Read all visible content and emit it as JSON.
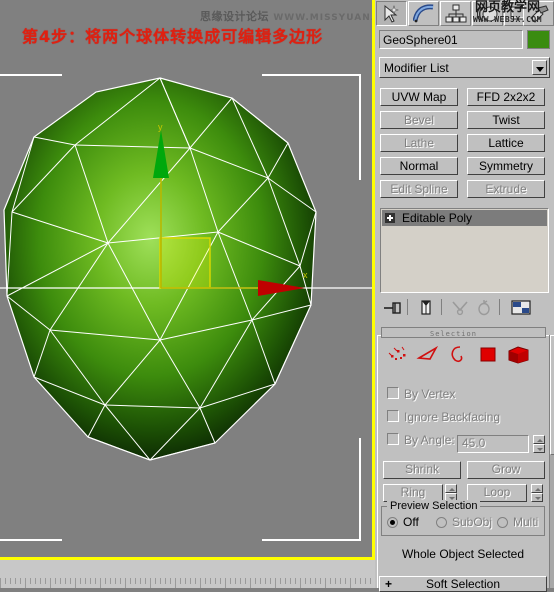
{
  "annotation": {
    "step_text": "第4步：将两个球体转换成可编辑多边形",
    "forum_name": "思缘设计论坛",
    "forum_url": "WWW.MISSYUAN.COM",
    "text_color": "#e02010"
  },
  "watermark": {
    "cn": "网页教学网",
    "en": "WWW.WEBJX.COM"
  },
  "viewport": {
    "background": "#808080",
    "active_border_color": "#ffff00",
    "object_color_light": "#8fd24a",
    "object_color_dark": "#0b2a05",
    "wireframe_color": "#ffffff",
    "gizmo": {
      "x_axis_label": "x",
      "y_axis_label": "y",
      "x_axis_color": "#d00000",
      "y_axis_color": "#00a000",
      "plane_color": "#ffff00"
    }
  },
  "command_panel": {
    "tabs": [
      {
        "name": "create-tab",
        "icon": "arrow-create-icon",
        "selected": false
      },
      {
        "name": "modify-tab",
        "icon": "curve-modify-icon",
        "selected": true
      },
      {
        "name": "hierarchy-tab",
        "icon": "hierarchy-icon",
        "selected": false
      },
      {
        "name": "motion-tab",
        "icon": "motion-wheel-icon",
        "selected": false
      },
      {
        "name": "display-tab",
        "icon": "display-icon",
        "selected": false
      },
      {
        "name": "utilities-tab",
        "icon": "hammer-icon",
        "selected": false
      }
    ],
    "object_name": "GeoSphere01",
    "object_color": "#3a8c10",
    "modifier_list_label": "Modifier List",
    "modifier_buttons": [
      {
        "label": "UVW Map",
        "disabled": false
      },
      {
        "label": "FFD 2x2x2",
        "disabled": false
      },
      {
        "label": "Bevel",
        "disabled": true
      },
      {
        "label": "Twist",
        "disabled": false
      },
      {
        "label": "Lathe",
        "disabled": true
      },
      {
        "label": "Lattice",
        "disabled": false
      },
      {
        "label": "Normal",
        "disabled": false
      },
      {
        "label": "Symmetry",
        "disabled": false
      },
      {
        "label": "Edit Spline",
        "disabled": true
      },
      {
        "label": "Extrude",
        "disabled": true
      }
    ],
    "stack": {
      "items": [
        {
          "label": "Editable Poly",
          "selected": true,
          "expandable": true
        }
      ],
      "tools": [
        {
          "name": "pin-stack-icon",
          "disabled": false
        },
        {
          "name": "show-end-result-icon",
          "disabled": false
        },
        {
          "name": "make-unique-icon",
          "disabled": true
        },
        {
          "name": "remove-modifier-icon",
          "disabled": true
        },
        {
          "name": "configure-modifier-sets-icon",
          "disabled": false
        }
      ]
    },
    "selection_rollout": {
      "title": "Selection",
      "sub_object_levels": [
        {
          "name": "vertex-level",
          "label": "Vertex"
        },
        {
          "name": "edge-level",
          "label": "Edge"
        },
        {
          "name": "border-level",
          "label": "Border"
        },
        {
          "name": "polygon-level",
          "label": "Polygon"
        },
        {
          "name": "element-level",
          "label": "Element"
        }
      ],
      "checkboxes": [
        {
          "label": "By Vertex",
          "checked": false,
          "disabled": true
        },
        {
          "label": "Ignore Backfacing",
          "checked": false,
          "disabled": true
        },
        {
          "label": "By Angle:",
          "checked": false,
          "disabled": true
        }
      ],
      "angle_value": "45.0",
      "buttons": [
        {
          "label": "Shrink",
          "disabled": true
        },
        {
          "label": "Grow",
          "disabled": true
        },
        {
          "label": "Ring",
          "disabled": true
        },
        {
          "label": "Loop",
          "disabled": true
        }
      ],
      "preview_selection": {
        "title": "Preview Selection",
        "options": [
          {
            "label": "Off",
            "selected": true,
            "disabled": false
          },
          {
            "label": "SubObj",
            "selected": false,
            "disabled": true
          },
          {
            "label": "Multi",
            "selected": false,
            "disabled": true
          }
        ]
      },
      "status_text": "Whole Object Selected"
    },
    "soft_selection_rollout": {
      "label": "Soft Selection",
      "expander": "+"
    }
  }
}
